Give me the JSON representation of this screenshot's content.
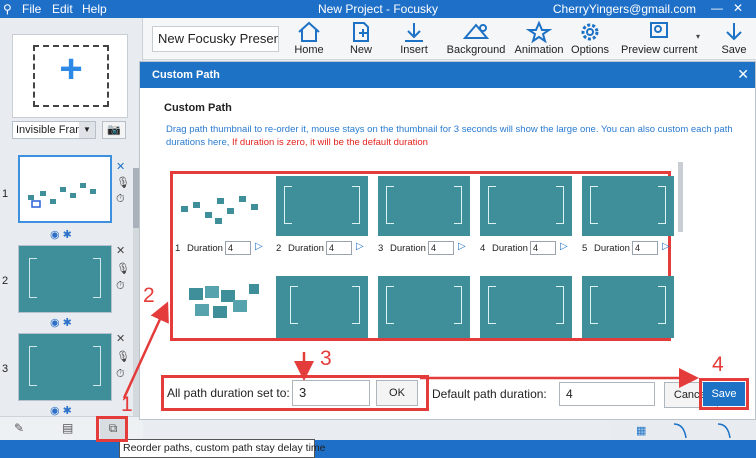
{
  "app": {
    "title": "New Project - Focusky",
    "user": "CherryYingers@gmail.com",
    "menu": [
      "File",
      "Edit",
      "Help"
    ]
  },
  "toolbar": {
    "project_name": "New Focusky Presenta",
    "buttons": [
      "Home",
      "New",
      "Insert",
      "Background",
      "Animation",
      "Options",
      "Preview current",
      "Save"
    ]
  },
  "left_panel": {
    "frame_type": "Invisible Fran",
    "slides": [
      "1",
      "2",
      "3"
    ]
  },
  "dialog": {
    "header": "Custom Path",
    "title": "Custom Path",
    "desc_blue": "Drag path thumbnail to re-order it, mouse stays on the thumbnail for 3 seconds will show the large one. You can also custom each path durations here, ",
    "desc_red": "If duration is zero, it will be the default duration",
    "duration_label": "Duration",
    "paths": [
      {
        "num": "1",
        "duration": "4"
      },
      {
        "num": "2",
        "duration": "4"
      },
      {
        "num": "3",
        "duration": "4"
      },
      {
        "num": "4",
        "duration": "4"
      },
      {
        "num": "5",
        "duration": "4"
      }
    ],
    "all_duration_label": "All path duration set to:",
    "all_duration_value": "3",
    "ok_label": "OK",
    "default_label": "Default path duration:",
    "default_value": "4",
    "cancel_label": "Cancel",
    "save_label": "Save"
  },
  "tooltip": "Reorder paths, custom path stay delay time",
  "annotations": [
    "1",
    "2",
    "3",
    "4"
  ],
  "colors": {
    "accent": "#1d72c6",
    "annotation": "#e43b3b",
    "slide": "#3e8f99"
  }
}
